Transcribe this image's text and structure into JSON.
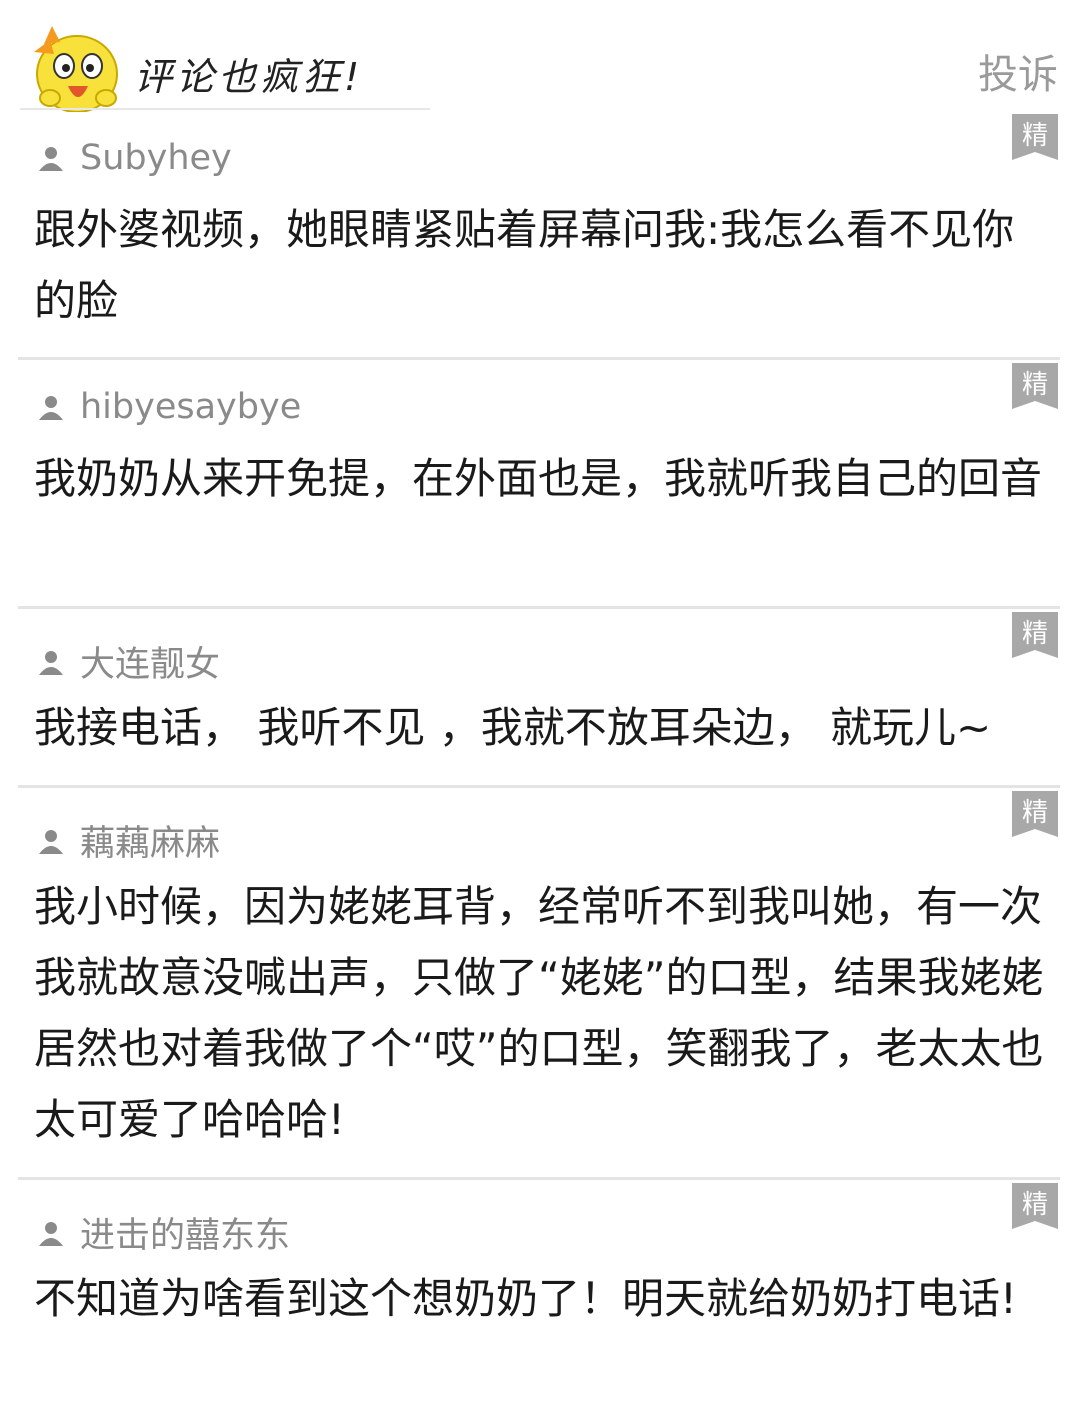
{
  "header": {
    "title": "评论也疯狂!",
    "report_label": "投诉"
  },
  "badge_label": "精",
  "comments": [
    {
      "user": "Subyhey",
      "text": "跟外婆视频，她眼睛紧贴着屏幕问我:我怎么看不见你的脸"
    },
    {
      "user": "hibyesaybye",
      "text": "我奶奶从来开免提，在外面也是，我就听我自己的回音"
    },
    {
      "user": "大连靓女",
      "text": "我接电话， 我听不见 ，我就不放耳朵边， 就玩儿~"
    },
    {
      "user": "藕藕麻麻",
      "text": "我小时候，因为姥姥耳背，经常听不到我叫她，有一次我就故意没喊出声，只做了“姥姥”的口型，结果我姥姥居然也对着我做了个“哎”的口型，笑翻我了，老太太也太可爱了哈哈哈!"
    },
    {
      "user": "进击的囍东东",
      "text": "不知道为啥看到这个想奶奶了！明天就给奶奶打电话!"
    }
  ]
}
